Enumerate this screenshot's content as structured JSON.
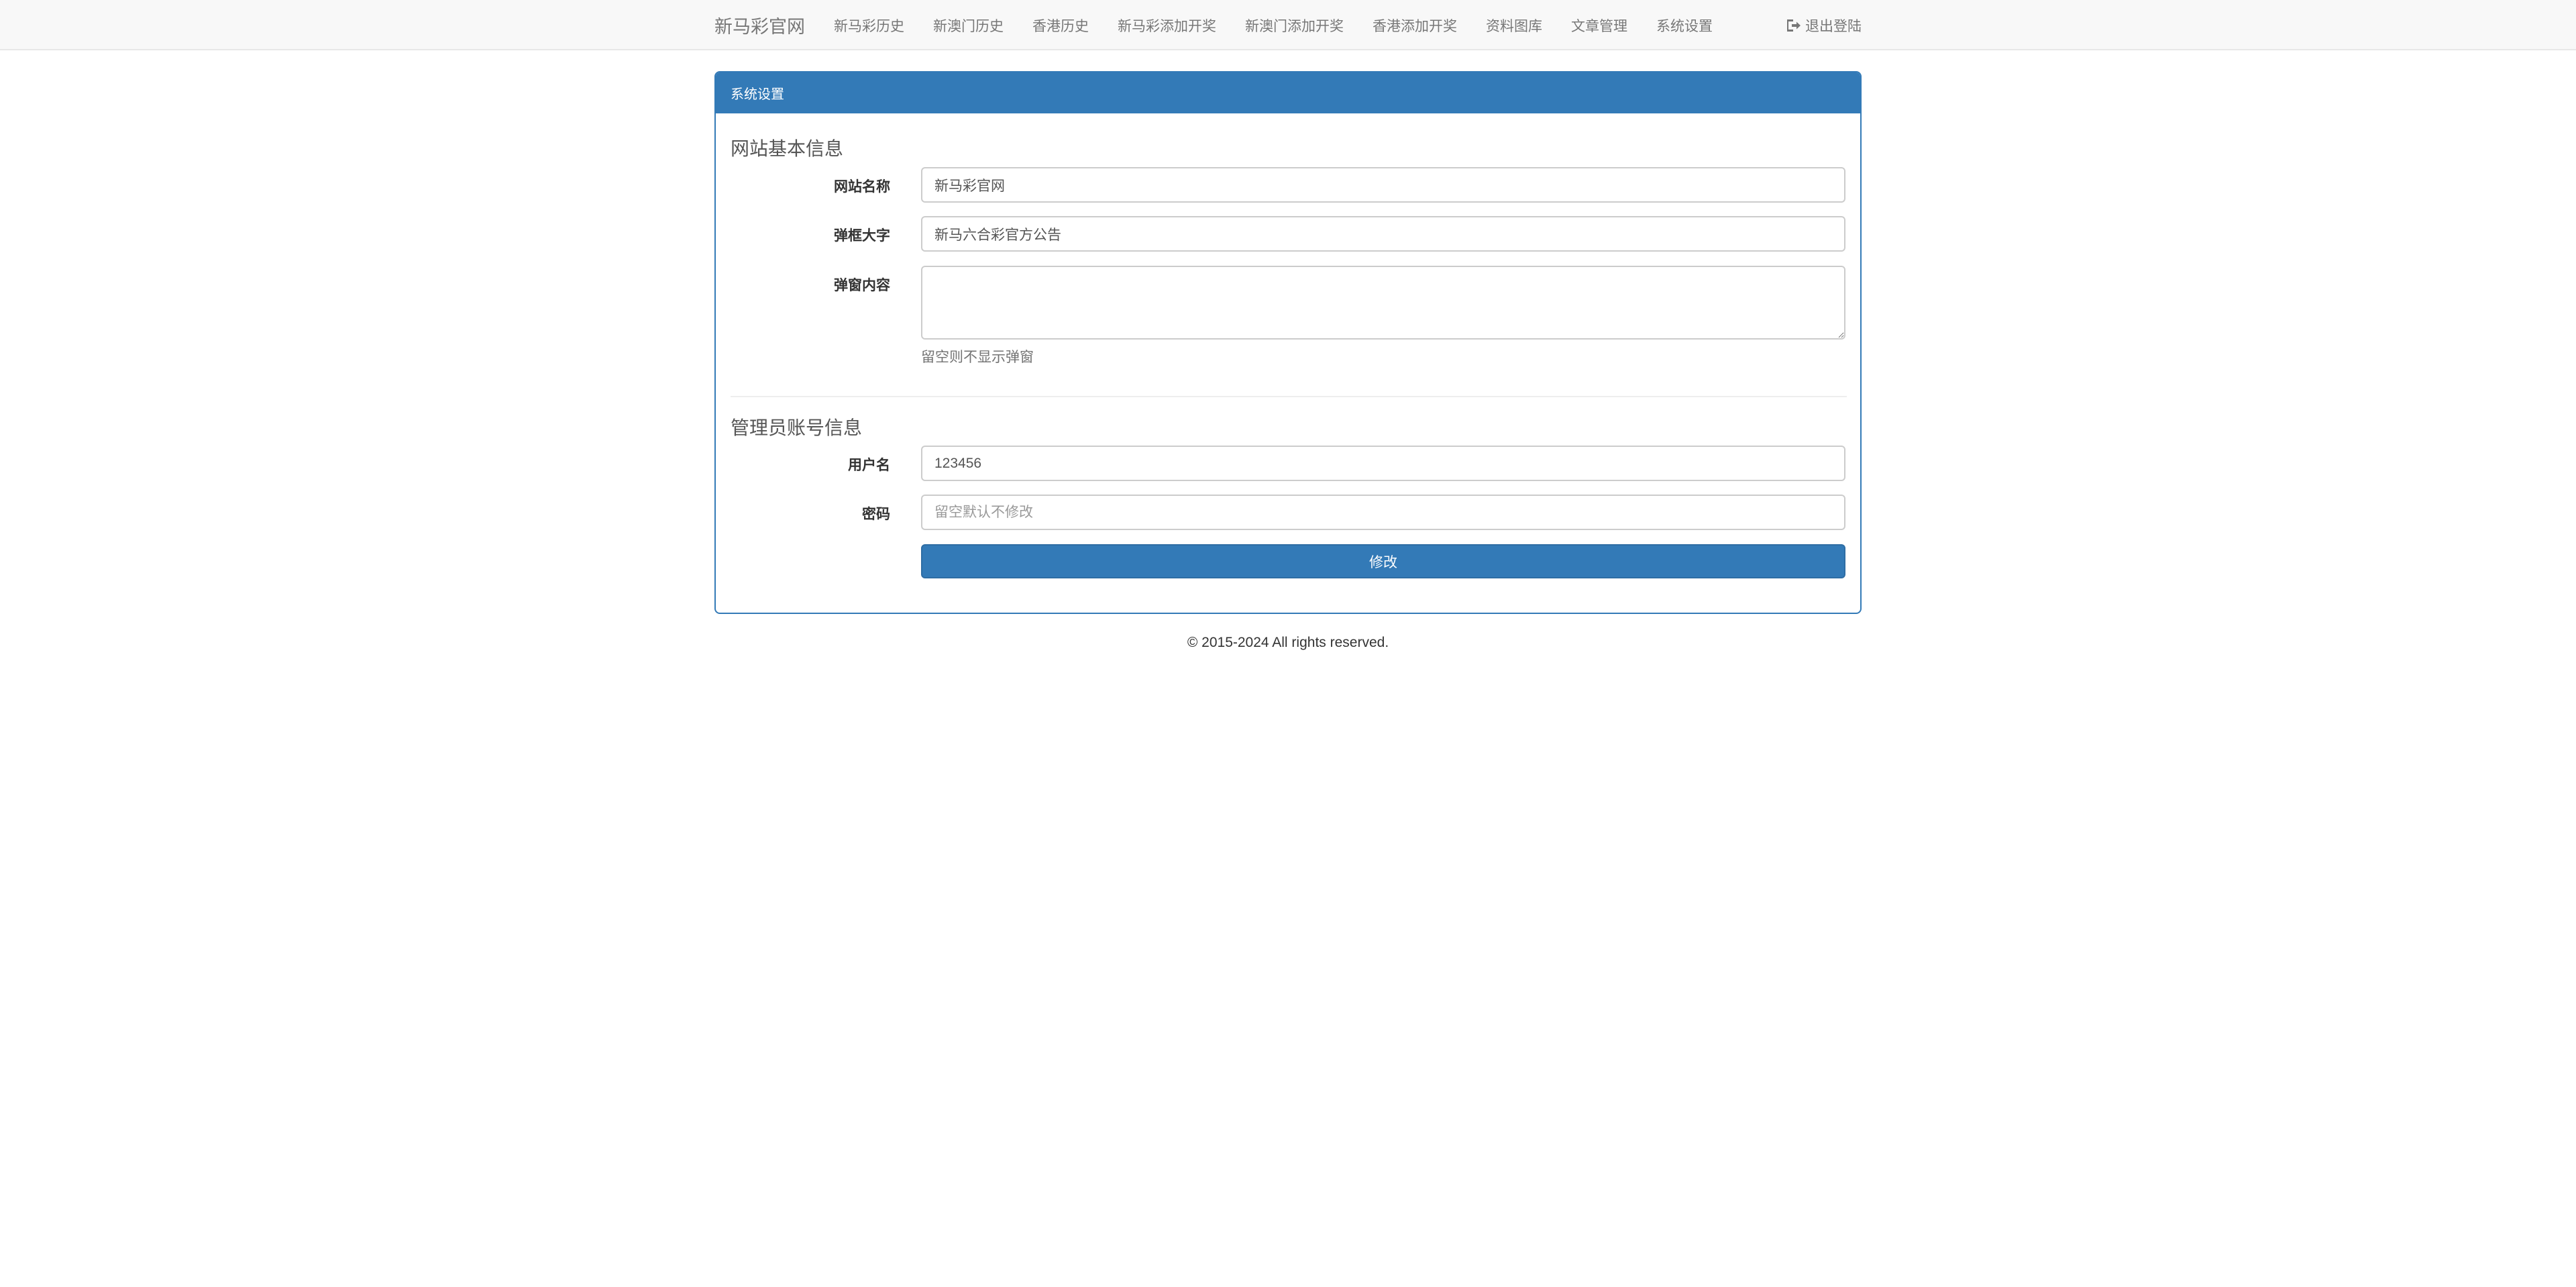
{
  "nav": {
    "brand": "新马彩官网",
    "items": [
      "新马彩历史",
      "新澳门历史",
      "香港历史",
      "新马彩添加开奖",
      "新澳门添加开奖",
      "香港添加开奖",
      "资料图库",
      "文章管理",
      "系统设置"
    ],
    "logout_label": "退出登陆",
    "logout_icon": "sign-out-icon"
  },
  "panel": {
    "title": "系统设置",
    "site_section": {
      "title": "网站基本信息",
      "site_name_label": "网站名称",
      "site_name_value": "新马彩官网",
      "popup_title_label": "弹框大字",
      "popup_title_value": "新马六合彩官方公告",
      "popup_content_label": "弹窗内容",
      "popup_content_value": "",
      "popup_help": "留空则不显示弹窗"
    },
    "admin_section": {
      "title": "管理员账号信息",
      "username_label": "用户名",
      "username_value": "123456",
      "password_label": "密码",
      "password_placeholder": "留空默认不修改",
      "submit_label": "修改"
    }
  },
  "footer": {
    "text": "© 2015-2024 All rights reserved."
  },
  "colors": {
    "primary": "#337ab7",
    "navbar_bg": "#f8f8f8",
    "nav_text": "#777777"
  }
}
